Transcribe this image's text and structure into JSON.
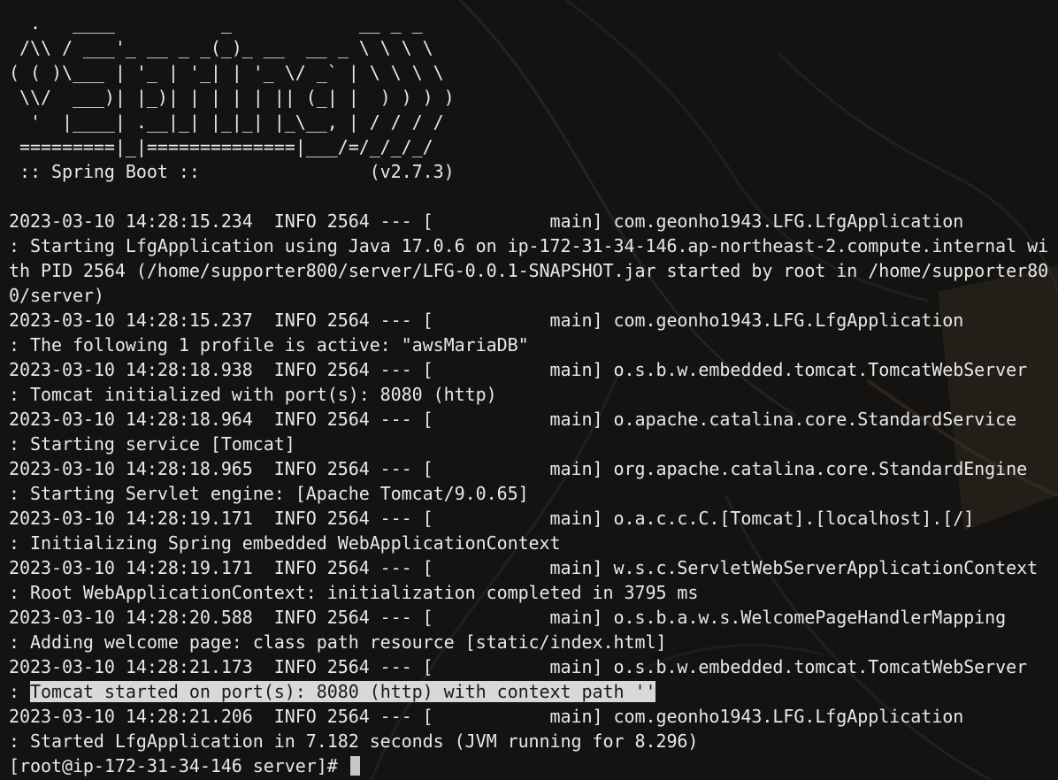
{
  "banner": [
    "  .   ____          _            __ _ _",
    " /\\\\ / ___'_ __ _ _(_)_ __  __ _ \\ \\ \\ \\",
    "( ( )\\___ | '_ | '_| | '_ \\/ _` | \\ \\ \\ \\",
    " \\\\/  ___)| |_)| | | | | || (_| |  ) ) ) )",
    "  '  |____| .__|_| |_|_| |_\\__, | / / / /",
    " =========|_|==============|___/=/_/_/_/",
    " :: Spring Boot ::                (v2.7.3)"
  ],
  "log": {
    "l1": "2023-03-10 14:28:15.234  INFO 2564 --- [           main] com.geonho1943.LFG.LfgApplication",
    "l2": ": Starting LfgApplication using Java 17.0.6 on ip-172-31-34-146.ap-northeast-2.compute.internal wi",
    "l3": "th PID 2564 (/home/supporter800/server/LFG-0.0.1-SNAPSHOT.jar started by root in /home/supporter80",
    "l4": "0/server)",
    "l5": "2023-03-10 14:28:15.237  INFO 2564 --- [           main] com.geonho1943.LFG.LfgApplication",
    "l6": ": The following 1 profile is active: \"awsMariaDB\"",
    "l7": "2023-03-10 14:28:18.938  INFO 2564 --- [           main] o.s.b.w.embedded.tomcat.TomcatWebServer",
    "l8": ": Tomcat initialized with port(s): 8080 (http)",
    "l9": "2023-03-10 14:28:18.964  INFO 2564 --- [           main] o.apache.catalina.core.StandardService",
    "l10": ": Starting service [Tomcat]",
    "l11": "2023-03-10 14:28:18.965  INFO 2564 --- [           main] org.apache.catalina.core.StandardEngine",
    "l12": ": Starting Servlet engine: [Apache Tomcat/9.0.65]",
    "l13": "2023-03-10 14:28:19.171  INFO 2564 --- [           main] o.a.c.c.C.[Tomcat].[localhost].[/]",
    "l14": ": Initializing Spring embedded WebApplicationContext",
    "l15": "2023-03-10 14:28:19.171  INFO 2564 --- [           main] w.s.c.ServletWebServerApplicationContext",
    "l16": ": Root WebApplicationContext: initialization completed in 3795 ms",
    "l17": "2023-03-10 14:28:20.588  INFO 2564 --- [           main] o.s.b.a.w.s.WelcomePageHandlerMapping",
    "l18": ": Adding welcome page: class path resource [static/index.html]",
    "l19": "2023-03-10 14:28:21.173  INFO 2564 --- [           main] o.s.b.w.embedded.tomcat.TomcatWebServer",
    "l20_prefix": ": ",
    "l20_highlight": "Tomcat started on port(s): 8080 (http) with context path ''",
    "l21": "2023-03-10 14:28:21.206  INFO 2564 --- [           main] com.geonho1943.LFG.LfgApplication",
    "l22": ": Started LfgApplication in 7.182 seconds (JVM running for 8.296)"
  },
  "prompt": "[root@ip-172-31-34-146 server]# "
}
